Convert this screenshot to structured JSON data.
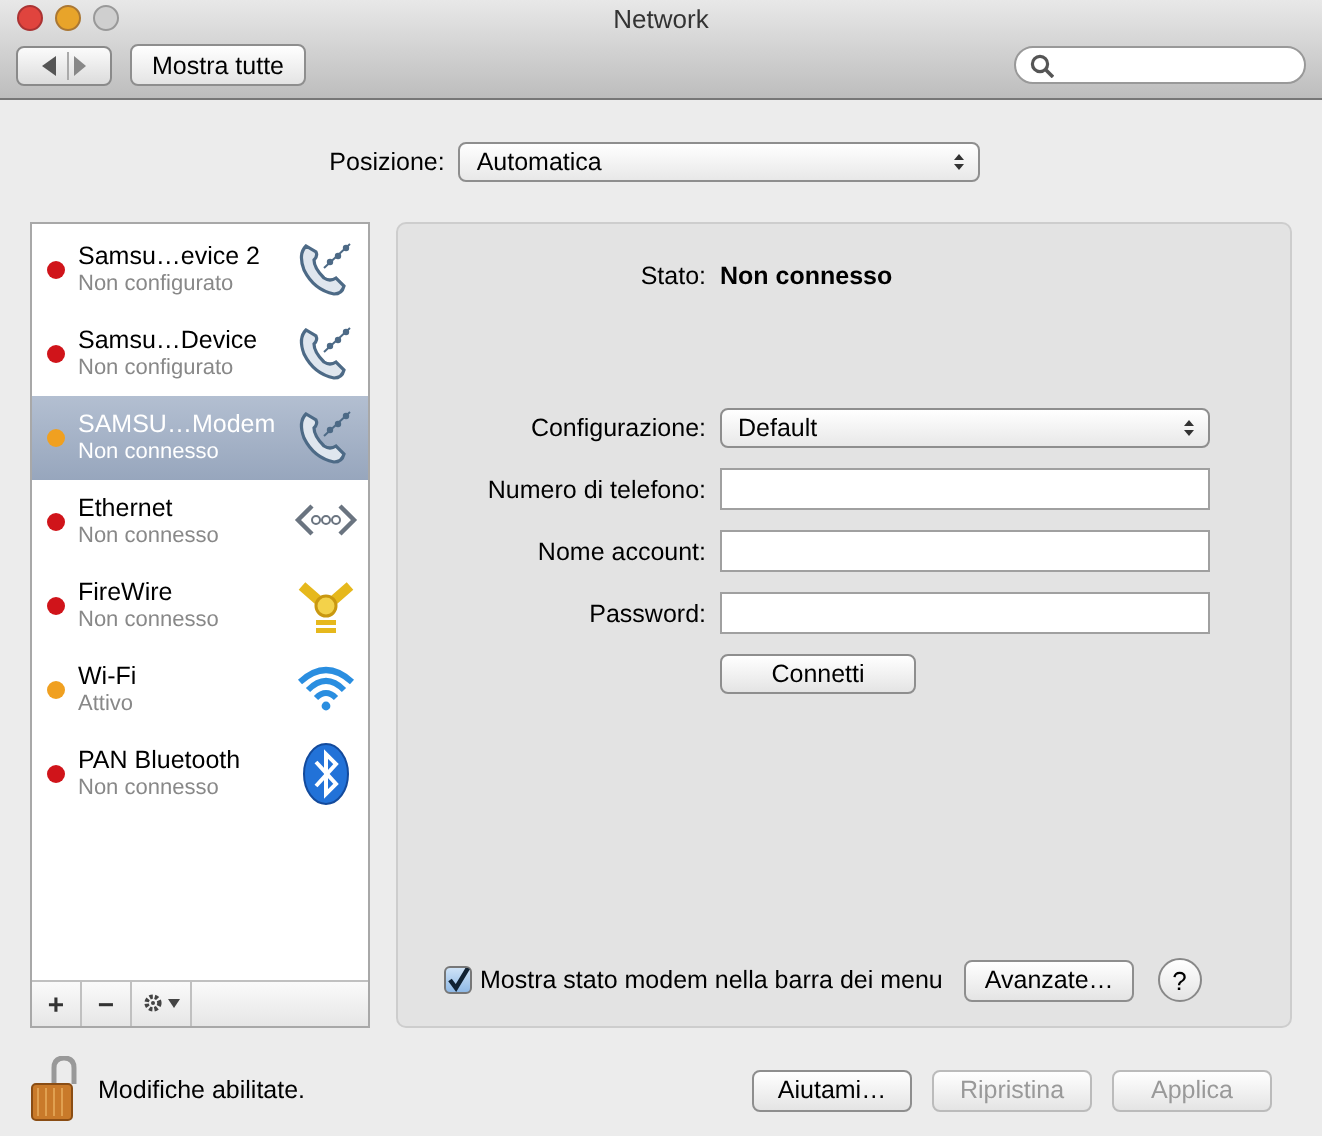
{
  "window": {
    "title": "Network"
  },
  "toolbar": {
    "show_all": "Mostra tutte"
  },
  "location": {
    "label": "Posizione:",
    "value": "Automatica"
  },
  "services": [
    {
      "name": "Samsu…evice 2",
      "status": "Non configurato",
      "color": "#d0141a",
      "kind": "phone",
      "selected": false
    },
    {
      "name": "Samsu…Device",
      "status": "Non configurato",
      "color": "#d0141a",
      "kind": "phone",
      "selected": false
    },
    {
      "name": "SAMSU…Modem",
      "status": "Non connesso",
      "color": "#f0a020",
      "kind": "phone",
      "selected": true
    },
    {
      "name": "Ethernet",
      "status": "Non connesso",
      "color": "#d0141a",
      "kind": "ethernet",
      "selected": false
    },
    {
      "name": "FireWire",
      "status": "Non connesso",
      "color": "#d0141a",
      "kind": "firewire",
      "selected": false
    },
    {
      "name": "Wi-Fi",
      "status": "Attivo",
      "color": "#f0a020",
      "kind": "wifi",
      "selected": false
    },
    {
      "name": "PAN Bluetooth",
      "status": "Non connesso",
      "color": "#d0141a",
      "kind": "bluetooth",
      "selected": false
    }
  ],
  "list_buttons": [
    "+",
    "−"
  ],
  "detail": {
    "status_label": "Stato:",
    "status_value": "Non connesso",
    "config_label": "Configurazione:",
    "config_value": "Default",
    "fields": [
      {
        "label": "Numero di telefono:"
      },
      {
        "label": "Nome account:"
      },
      {
        "label": "Password:"
      }
    ],
    "connect": "Connetti",
    "show_modem": {
      "label": "Mostra stato modem nella barra dei menu",
      "checked": true
    },
    "advanced": "Avanzate…",
    "help": "?"
  },
  "lock": {
    "label": "Modifiche abilitate."
  },
  "buttons": [
    {
      "label": "Aiutami…",
      "disabled": false
    },
    {
      "label": "Ripristina",
      "disabled": true
    },
    {
      "label": "Applica",
      "disabled": true
    }
  ]
}
